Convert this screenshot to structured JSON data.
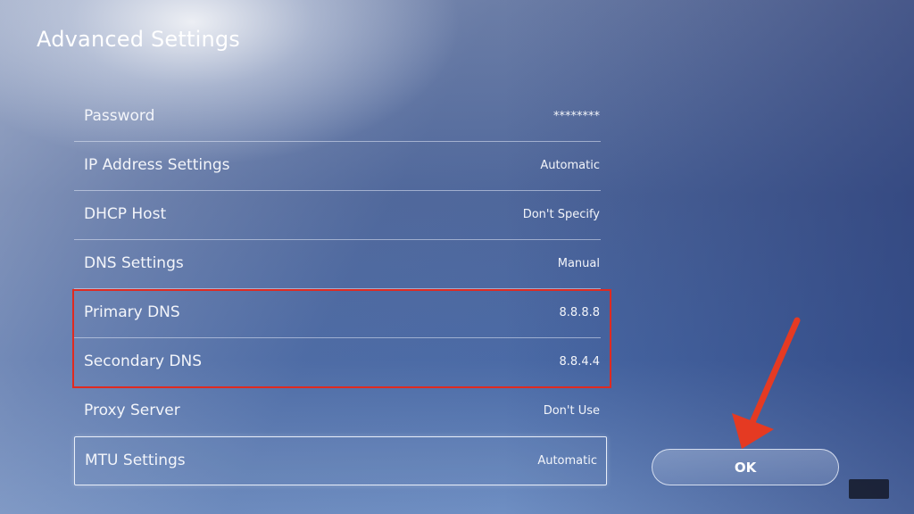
{
  "page": {
    "title": "Advanced Settings"
  },
  "settings": [
    {
      "label": "Password",
      "value": "********"
    },
    {
      "label": "IP Address Settings",
      "value": "Automatic"
    },
    {
      "label": "DHCP Host",
      "value": "Don't Specify"
    },
    {
      "label": "DNS Settings",
      "value": "Manual"
    },
    {
      "label": "Primary DNS",
      "value": "8.8.8.8"
    },
    {
      "label": "Secondary DNS",
      "value": "8.8.4.4"
    },
    {
      "label": "Proxy Server",
      "value": "Don't Use"
    },
    {
      "label": "MTU Settings",
      "value": "Automatic"
    }
  ],
  "ok_button": {
    "label": "OK"
  },
  "annotations": {
    "highlight_color": "#e02a20",
    "arrow_color": "#e53a22"
  },
  "selected_setting": "MTU Settings"
}
